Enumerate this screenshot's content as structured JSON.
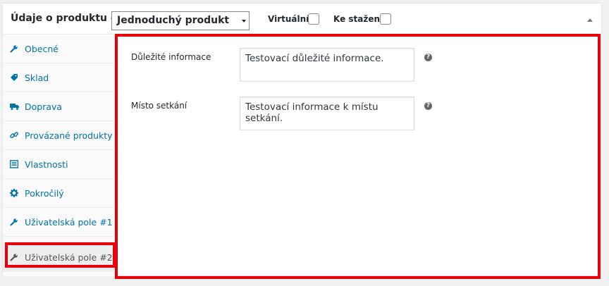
{
  "header": {
    "title": "Údaje o produktu —",
    "product_type": "Jednoduchý produkt",
    "virtual_label": "Virtuální:",
    "download_label": "Ke stažení:"
  },
  "tabs": [
    {
      "label": "Obecné",
      "icon": "wrench-icon"
    },
    {
      "label": "Sklad",
      "icon": "tag-icon"
    },
    {
      "label": "Doprava",
      "icon": "truck-icon"
    },
    {
      "label": "Provázané produkty",
      "icon": "link-icon"
    },
    {
      "label": "Vlastnosti",
      "icon": "list-icon"
    },
    {
      "label": "Pokročilý",
      "icon": "gear-icon"
    },
    {
      "label": "Uživatelská pole #1",
      "icon": "wrench-icon"
    },
    {
      "label": "Uživatelská pole #2",
      "icon": "wrench-icon",
      "active": true
    }
  ],
  "fields": [
    {
      "label": "Důležité informace",
      "value": "Testovací důležité informace.",
      "help": "?"
    },
    {
      "label": "Místo setkání",
      "value": "Testovací informace k místu setkání.",
      "help": "?"
    }
  ],
  "colors": {
    "accent": "#0073aa",
    "highlight": "#e8000b"
  }
}
